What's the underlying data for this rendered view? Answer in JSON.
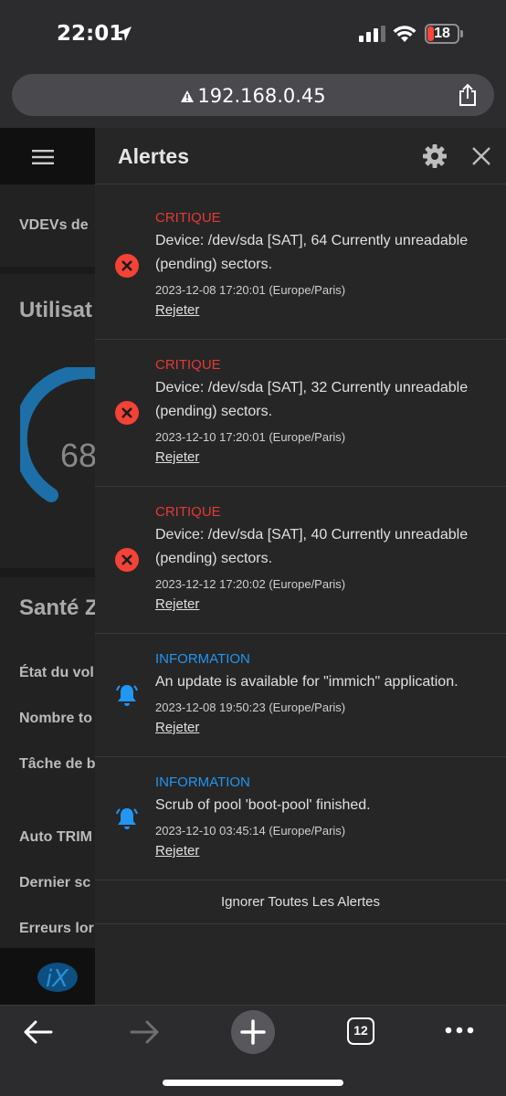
{
  "status_bar": {
    "time": "22:01",
    "battery": "18"
  },
  "browser": {
    "url": "192.168.0.45",
    "tab_count": "12"
  },
  "background_app": {
    "row_vdevs": "VDEVs de",
    "title_usage": "Utilisat",
    "gauge_value": "68",
    "title_health": "Santé Z",
    "rows": [
      "État du vol",
      "Nombre to",
      "Tâche de b",
      "Auto TRIM",
      "Dernier sc",
      "Erreurs lor"
    ]
  },
  "panel": {
    "title": "Alertes",
    "alerts": [
      {
        "level": "CRITIQUE",
        "message_line1": "Device: /dev/sda [SAT], 64 Currently unreadable",
        "message_line2": "(pending) sectors.",
        "timestamp": "2023-12-08 17:20:01 (Europe/Paris)",
        "dismiss": "Rejeter"
      },
      {
        "level": "CRITIQUE",
        "message_line1": "Device: /dev/sda [SAT], 32 Currently unreadable",
        "message_line2": "(pending) sectors.",
        "timestamp": "2023-12-10 17:20:01 (Europe/Paris)",
        "dismiss": "Rejeter"
      },
      {
        "level": "CRITIQUE",
        "message_line1": "Device: /dev/sda [SAT], 40 Currently unreadable",
        "message_line2": "(pending) sectors.",
        "timestamp": "2023-12-12 17:20:02 (Europe/Paris)",
        "dismiss": "Rejeter"
      },
      {
        "level": "INFORMATION",
        "message_line1": "An update is available for \"immich\" application.",
        "timestamp": "2023-12-08 19:50:23 (Europe/Paris)",
        "dismiss": "Rejeter"
      },
      {
        "level": "INFORMATION",
        "message_line1": "Scrub of pool 'boot-pool' finished.",
        "timestamp": "2023-12-10 03:45:14 (Europe/Paris)",
        "dismiss": "Rejeter"
      }
    ],
    "ignore_all": "Ignorer Toutes Les Alertes"
  },
  "colors": {
    "critical": "#e53935",
    "info": "#2196f3",
    "panel_bg": "#262626"
  }
}
